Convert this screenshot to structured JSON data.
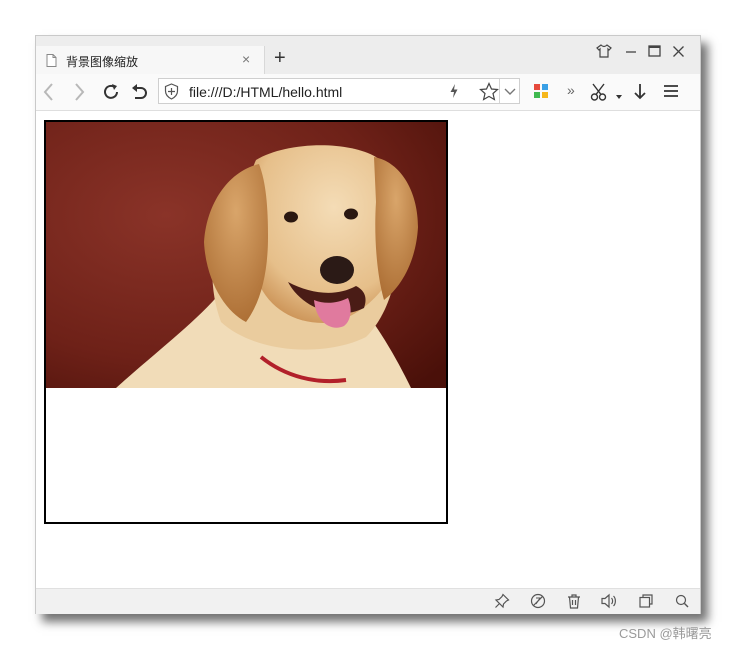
{
  "tab": {
    "title": "背景图像缩放",
    "close_glyph": "×"
  },
  "new_tab": "+",
  "address_bar": {
    "url": "file:///D:/HTML/hello.html"
  },
  "toolbar": {
    "more_glyph": "»"
  },
  "watermark": "CSDN @韩曙亮",
  "colors": {
    "tabbar": "#ededed",
    "toolbar": "#fafafa",
    "statusbar": "#f1f1f1",
    "photo_background": "#6e2118"
  }
}
